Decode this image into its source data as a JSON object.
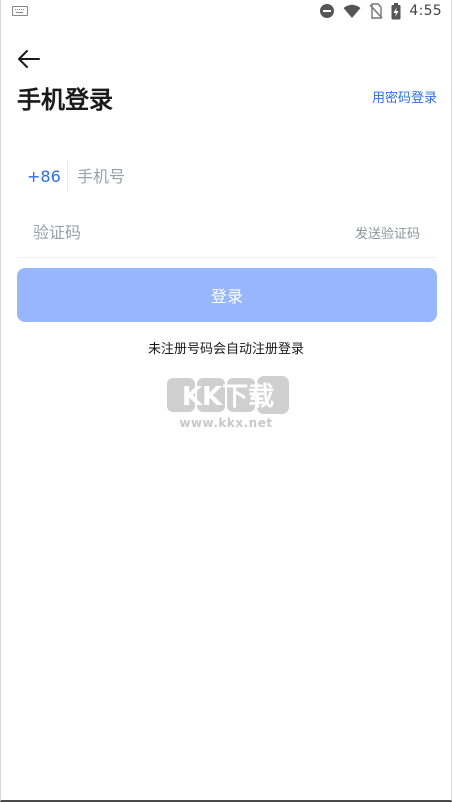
{
  "status_bar": {
    "time": "4:55",
    "icons": [
      "keyboard-icon",
      "do-not-disturb-icon",
      "wifi-icon",
      "no-sim-icon",
      "battery-charging-icon"
    ]
  },
  "header": {
    "title": "手机登录",
    "password_login_link": "用密码登录"
  },
  "form": {
    "country_code": "+86",
    "phone_placeholder": "手机号",
    "phone_value": "",
    "code_placeholder": "验证码",
    "code_value": "",
    "send_code_label": "发送验证码",
    "login_label": "登录"
  },
  "hint": "未注册号码会自动注册登录",
  "watermark": {
    "logo_text": "KK下载",
    "url": "www.kkx.net"
  },
  "colors": {
    "accent": "#2e6ee6",
    "button_disabled": "#98b6fc",
    "placeholder": "#9aa0a8"
  }
}
